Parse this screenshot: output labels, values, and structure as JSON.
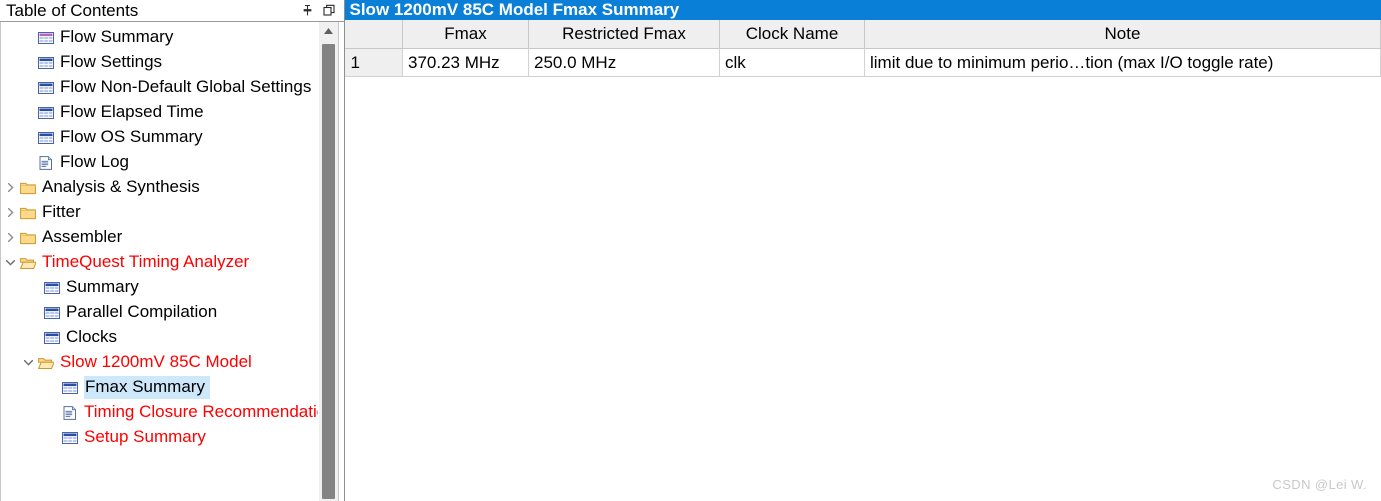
{
  "toc": {
    "title": "Table of Contents",
    "header_buttons": [
      {
        "name": "auto-hide-pin",
        "icon": "pin-icon"
      },
      {
        "name": "restore-window",
        "icon": "restore-window-icon"
      }
    ],
    "items": [
      {
        "label": "Flow Summary",
        "icon": "table-report-icon-purple",
        "indent": 1,
        "chevron": "none",
        "color": "black",
        "selected": false
      },
      {
        "label": "Flow Settings",
        "icon": "table-report-icon",
        "indent": 1,
        "chevron": "none",
        "color": "black",
        "selected": false
      },
      {
        "label": "Flow Non-Default Global Settings",
        "icon": "table-report-icon",
        "indent": 1,
        "chevron": "none",
        "color": "black",
        "selected": false
      },
      {
        "label": "Flow Elapsed Time",
        "icon": "table-report-icon",
        "indent": 1,
        "chevron": "none",
        "color": "black",
        "selected": false
      },
      {
        "label": "Flow OS Summary",
        "icon": "table-report-icon",
        "indent": 1,
        "chevron": "none",
        "color": "black",
        "selected": false
      },
      {
        "label": "Flow Log",
        "icon": "document-icon",
        "indent": 1,
        "chevron": "none",
        "color": "black",
        "selected": false
      },
      {
        "label": "Analysis & Synthesis",
        "icon": "folder-closed-icon",
        "indent": 0,
        "chevron": "collapsed",
        "color": "black",
        "selected": false
      },
      {
        "label": "Fitter",
        "icon": "folder-closed-icon",
        "indent": 0,
        "chevron": "collapsed",
        "color": "black",
        "selected": false
      },
      {
        "label": "Assembler",
        "icon": "folder-closed-icon",
        "indent": 0,
        "chevron": "collapsed",
        "color": "black",
        "selected": false
      },
      {
        "label": "TimeQuest Timing Analyzer",
        "icon": "folder-open-icon",
        "indent": 0,
        "chevron": "expanded",
        "color": "red",
        "selected": false
      },
      {
        "label": "Summary",
        "icon": "table-report-icon",
        "indent": 2,
        "chevron": "none",
        "color": "black",
        "selected": false
      },
      {
        "label": "Parallel Compilation",
        "icon": "table-report-icon",
        "indent": 2,
        "chevron": "none",
        "color": "black",
        "selected": false
      },
      {
        "label": "Clocks",
        "icon": "table-report-icon",
        "indent": 2,
        "chevron": "none",
        "color": "black",
        "selected": false
      },
      {
        "label": "Slow 1200mV 85C Model",
        "icon": "folder-open-icon",
        "indent": 1,
        "chevron": "expanded",
        "color": "red",
        "selected": false
      },
      {
        "label": "Fmax Summary",
        "icon": "table-report-icon",
        "indent": 3,
        "chevron": "none",
        "color": "black",
        "selected": true
      },
      {
        "label": "Timing Closure Recommendations",
        "icon": "document-icon",
        "indent": 3,
        "chevron": "none",
        "color": "red",
        "selected": false
      },
      {
        "label": "Setup Summary",
        "icon": "table-report-icon",
        "indent": 3,
        "chevron": "none",
        "color": "red",
        "selected": false
      }
    ],
    "scrollbar": {
      "up_arrow": "scroll-up-arrow-icon"
    }
  },
  "report": {
    "title": "Slow 1200mV 85C Model Fmax Summary",
    "title_bar_color": "#0a7fd8",
    "columns": [
      "",
      "Fmax",
      "Restricted Fmax",
      "Clock Name",
      "Note"
    ],
    "rows": [
      {
        "num": "1",
        "fmax": "370.23 MHz",
        "restricted_fmax": "250.0 MHz",
        "clock_name": "clk",
        "note": "limit due to minimum perio…tion (max I/O toggle rate)"
      }
    ]
  },
  "watermark": "CSDN @Lei W."
}
